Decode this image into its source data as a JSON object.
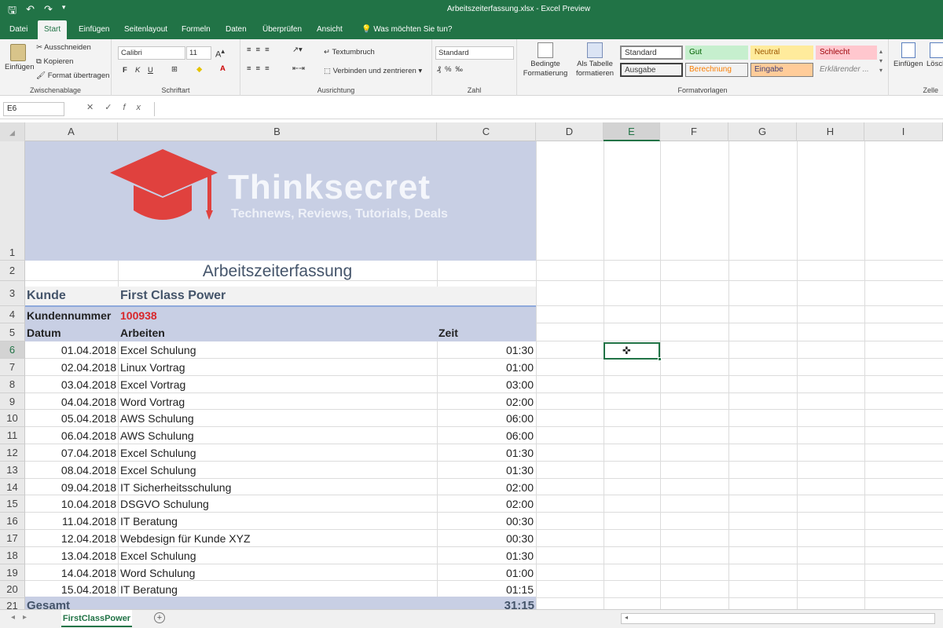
{
  "window": {
    "title": "Arbeitszeiterfassung.xlsx  -  Excel Preview"
  },
  "qat": {
    "save_icon": "save-icon",
    "undo_icon": "undo-icon",
    "redo_icon": "redo-icon"
  },
  "tabs": [
    "Datei",
    "Start",
    "Einfügen",
    "Seitenlayout",
    "Formeln",
    "Daten",
    "Überprüfen",
    "Ansicht",
    "Was möchten Sie tun?"
  ],
  "ribbon": {
    "clipboard": {
      "paste": "Einfügen",
      "cut": "Ausschneiden",
      "copy": "Kopieren",
      "format_painter": "Format übertragen",
      "label": "Zwischenablage"
    },
    "font": {
      "name": "Calibri",
      "size": "11",
      "bold": "F",
      "italic": "K",
      "underline": "U",
      "label": "Schriftart"
    },
    "alignment": {
      "wrap": "Textumbruch",
      "merge": "Verbinden und zentrieren",
      "label": "Ausrichtung"
    },
    "number": {
      "format": "Standard",
      "label": "Zahl"
    },
    "styles": {
      "cond_format": "Bedingte Formatierung",
      "as_table": "Als Tabelle formatieren",
      "cells": [
        "Standard",
        "Gut",
        "Neutral",
        "Schlecht",
        "Ausgabe",
        "Berechnung",
        "Eingabe",
        "Erklärender ..."
      ],
      "label": "Formatvorlagen"
    },
    "cells_grp": {
      "insert": "Einfügen",
      "delete": "Lösch",
      "label": "Zelle"
    }
  },
  "formula_bar": {
    "name_box": "E6",
    "value": ""
  },
  "columns": [
    "A",
    "B",
    "C",
    "D",
    "E",
    "F",
    "G",
    "H",
    "I"
  ],
  "rows": [
    "1",
    "2",
    "3",
    "4",
    "5",
    "6",
    "7",
    "8",
    "9",
    "10",
    "11",
    "12",
    "13",
    "14",
    "15",
    "16",
    "17",
    "18",
    "19",
    "20",
    "21"
  ],
  "sheet": {
    "logo": {
      "title": "Thinksecret",
      "subtitle": "Technews, Reviews, Tutorials, Deals"
    },
    "heading": "Arbeitszeiterfassung",
    "customer_label": "Kunde",
    "customer_value": "First Class Power",
    "number_label": "Kundennummer",
    "number_value": "100938",
    "col_date": "Datum",
    "col_work": "Arbeiten",
    "col_time": "Zeit",
    "entries": [
      {
        "date": "01.04.2018",
        "work": "Excel Schulung",
        "time": "01:30"
      },
      {
        "date": "02.04.2018",
        "work": "Linux Vortrag",
        "time": "01:00"
      },
      {
        "date": "03.04.2018",
        "work": "Excel Vortrag",
        "time": "03:00"
      },
      {
        "date": "04.04.2018",
        "work": "Word Vortrag",
        "time": "02:00"
      },
      {
        "date": "05.04.2018",
        "work": "AWS Schulung",
        "time": "06:00"
      },
      {
        "date": "06.04.2018",
        "work": "AWS Schulung",
        "time": "06:00"
      },
      {
        "date": "07.04.2018",
        "work": "Excel Schulung",
        "time": "01:30"
      },
      {
        "date": "08.04.2018",
        "work": "Excel Schulung",
        "time": "01:30"
      },
      {
        "date": "09.04.2018",
        "work": "IT Sicherheitsschulung",
        "time": "02:00"
      },
      {
        "date": "10.04.2018",
        "work": "DSGVO Schulung",
        "time": "02:00"
      },
      {
        "date": "11.04.2018",
        "work": "IT Beratung",
        "time": "00:30"
      },
      {
        "date": "12.04.2018",
        "work": "Webdesign für Kunde XYZ",
        "time": "00:30"
      },
      {
        "date": "13.04.2018",
        "work": "Excel Schulung",
        "time": "01:30"
      },
      {
        "date": "14.04.2018",
        "work": "Word Schulung",
        "time": "01:00"
      },
      {
        "date": "15.04.2018",
        "work": "IT Beratung",
        "time": "01:15"
      }
    ],
    "total_label": "Gesamt",
    "total_value": "31:15"
  },
  "sheet_tabs": [
    "FirstClassPower"
  ],
  "colors": {
    "excel_green": "#217346",
    "header_band": "#c8cfe4",
    "logo_red": "#e0413e",
    "number_red": "#d9262a"
  }
}
